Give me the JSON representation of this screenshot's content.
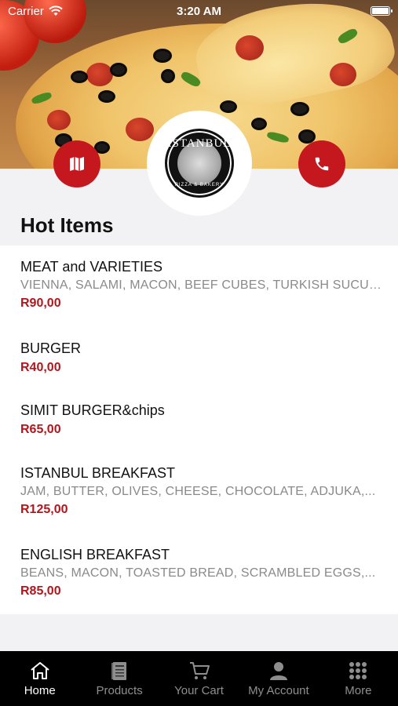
{
  "status_bar": {
    "carrier": "Carrier",
    "time": "3:20 AM"
  },
  "hero": {
    "image": "pizza-photo"
  },
  "actions": {
    "map_icon": "map-icon",
    "phone_icon": "phone-icon"
  },
  "logo": {
    "name": "ISTANBUL",
    "tagline": "PIZZA & BAKERY"
  },
  "section": {
    "title": "Hot Items"
  },
  "items": [
    {
      "title": "MEAT and VARIETIES",
      "desc": "VIENNA, SALAMI, MACON, BEEF CUBES, TURKISH SUCUK...",
      "price": "R90,00"
    },
    {
      "title": "BURGER",
      "desc": "",
      "price": "R40,00"
    },
    {
      "title": "SIMIT BURGER&chips",
      "desc": "",
      "price": "R65,00"
    },
    {
      "title": "ISTANBUL BREAKFAST",
      "desc": "JAM, BUTTER, OLIVES, CHEESE, CHOCOLATE, ADJUKA,...",
      "price": "R125,00"
    },
    {
      "title": "ENGLISH BREAKFAST",
      "desc": "BEANS, MACON, TOASTED BREAD, SCRAMBLED EGGS,...",
      "price": "R85,00"
    }
  ],
  "tabs": [
    {
      "label": "Home",
      "icon": "home-icon",
      "active": true
    },
    {
      "label": "Products",
      "icon": "menu-book-icon",
      "active": false
    },
    {
      "label": "Your Cart",
      "icon": "cart-icon",
      "active": false
    },
    {
      "label": "My Account",
      "icon": "user-icon",
      "active": false
    },
    {
      "label": "More",
      "icon": "grid-icon",
      "active": false
    }
  ],
  "colors": {
    "accent": "#c5171e",
    "price": "#b3151c",
    "tabbar": "#000000",
    "background": "#f2f2f4"
  }
}
